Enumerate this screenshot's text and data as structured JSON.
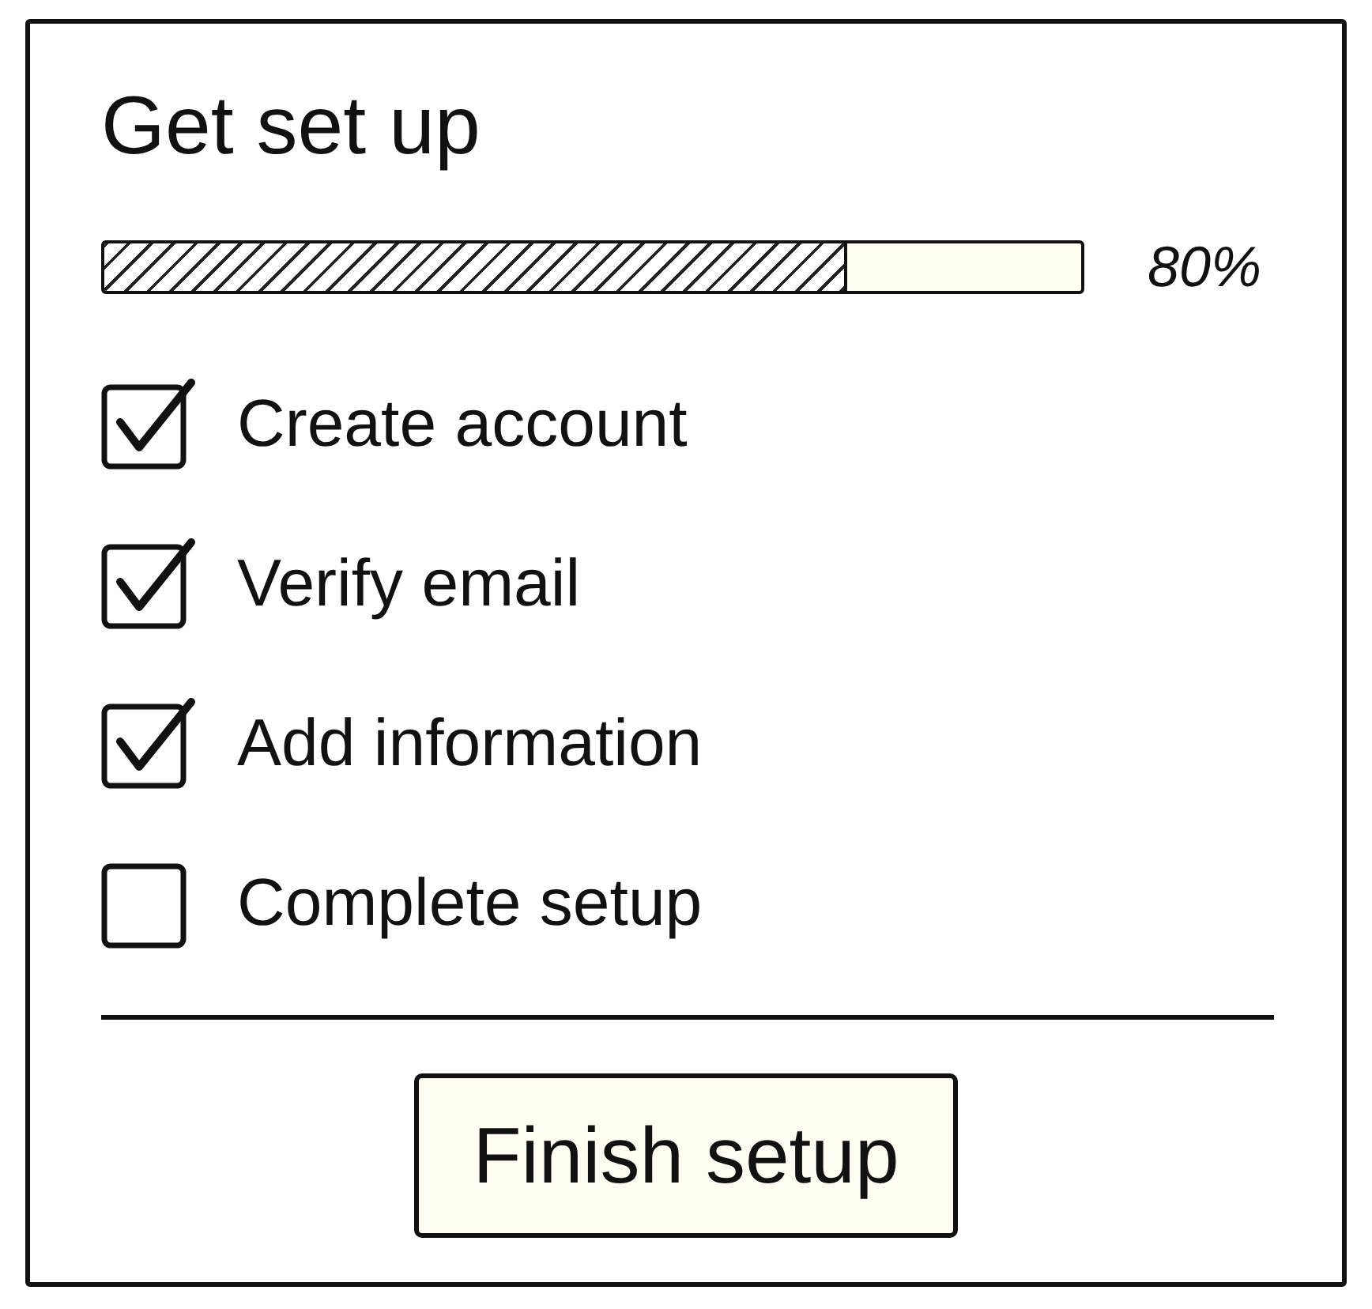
{
  "title": "Get set up",
  "progress": {
    "level": 0.76,
    "reading": "80%"
  },
  "tasks": [
    {
      "label": "Create account",
      "checked": true
    },
    {
      "label": "Verify email",
      "checked": true
    },
    {
      "label": "Add information",
      "checked": true
    },
    {
      "label": "Complete setup",
      "checked": false
    }
  ],
  "button": {
    "label": "Finish setup"
  }
}
